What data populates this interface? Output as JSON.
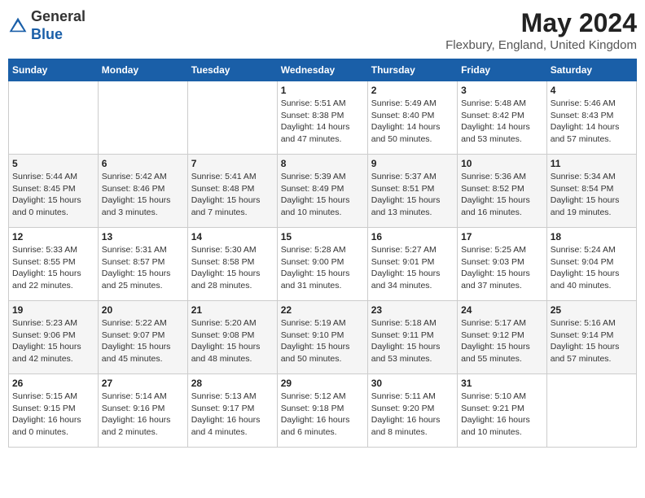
{
  "header": {
    "logo_line1": "General",
    "logo_line2": "Blue",
    "month_year": "May 2024",
    "location": "Flexbury, England, United Kingdom"
  },
  "days_of_week": [
    "Sunday",
    "Monday",
    "Tuesday",
    "Wednesday",
    "Thursday",
    "Friday",
    "Saturday"
  ],
  "weeks": [
    [
      {
        "day": "",
        "info": ""
      },
      {
        "day": "",
        "info": ""
      },
      {
        "day": "",
        "info": ""
      },
      {
        "day": "1",
        "info": "Sunrise: 5:51 AM\nSunset: 8:38 PM\nDaylight: 14 hours\nand 47 minutes."
      },
      {
        "day": "2",
        "info": "Sunrise: 5:49 AM\nSunset: 8:40 PM\nDaylight: 14 hours\nand 50 minutes."
      },
      {
        "day": "3",
        "info": "Sunrise: 5:48 AM\nSunset: 8:42 PM\nDaylight: 14 hours\nand 53 minutes."
      },
      {
        "day": "4",
        "info": "Sunrise: 5:46 AM\nSunset: 8:43 PM\nDaylight: 14 hours\nand 57 minutes."
      }
    ],
    [
      {
        "day": "5",
        "info": "Sunrise: 5:44 AM\nSunset: 8:45 PM\nDaylight: 15 hours\nand 0 minutes."
      },
      {
        "day": "6",
        "info": "Sunrise: 5:42 AM\nSunset: 8:46 PM\nDaylight: 15 hours\nand 3 minutes."
      },
      {
        "day": "7",
        "info": "Sunrise: 5:41 AM\nSunset: 8:48 PM\nDaylight: 15 hours\nand 7 minutes."
      },
      {
        "day": "8",
        "info": "Sunrise: 5:39 AM\nSunset: 8:49 PM\nDaylight: 15 hours\nand 10 minutes."
      },
      {
        "day": "9",
        "info": "Sunrise: 5:37 AM\nSunset: 8:51 PM\nDaylight: 15 hours\nand 13 minutes."
      },
      {
        "day": "10",
        "info": "Sunrise: 5:36 AM\nSunset: 8:52 PM\nDaylight: 15 hours\nand 16 minutes."
      },
      {
        "day": "11",
        "info": "Sunrise: 5:34 AM\nSunset: 8:54 PM\nDaylight: 15 hours\nand 19 minutes."
      }
    ],
    [
      {
        "day": "12",
        "info": "Sunrise: 5:33 AM\nSunset: 8:55 PM\nDaylight: 15 hours\nand 22 minutes."
      },
      {
        "day": "13",
        "info": "Sunrise: 5:31 AM\nSunset: 8:57 PM\nDaylight: 15 hours\nand 25 minutes."
      },
      {
        "day": "14",
        "info": "Sunrise: 5:30 AM\nSunset: 8:58 PM\nDaylight: 15 hours\nand 28 minutes."
      },
      {
        "day": "15",
        "info": "Sunrise: 5:28 AM\nSunset: 9:00 PM\nDaylight: 15 hours\nand 31 minutes."
      },
      {
        "day": "16",
        "info": "Sunrise: 5:27 AM\nSunset: 9:01 PM\nDaylight: 15 hours\nand 34 minutes."
      },
      {
        "day": "17",
        "info": "Sunrise: 5:25 AM\nSunset: 9:03 PM\nDaylight: 15 hours\nand 37 minutes."
      },
      {
        "day": "18",
        "info": "Sunrise: 5:24 AM\nSunset: 9:04 PM\nDaylight: 15 hours\nand 40 minutes."
      }
    ],
    [
      {
        "day": "19",
        "info": "Sunrise: 5:23 AM\nSunset: 9:06 PM\nDaylight: 15 hours\nand 42 minutes."
      },
      {
        "day": "20",
        "info": "Sunrise: 5:22 AM\nSunset: 9:07 PM\nDaylight: 15 hours\nand 45 minutes."
      },
      {
        "day": "21",
        "info": "Sunrise: 5:20 AM\nSunset: 9:08 PM\nDaylight: 15 hours\nand 48 minutes."
      },
      {
        "day": "22",
        "info": "Sunrise: 5:19 AM\nSunset: 9:10 PM\nDaylight: 15 hours\nand 50 minutes."
      },
      {
        "day": "23",
        "info": "Sunrise: 5:18 AM\nSunset: 9:11 PM\nDaylight: 15 hours\nand 53 minutes."
      },
      {
        "day": "24",
        "info": "Sunrise: 5:17 AM\nSunset: 9:12 PM\nDaylight: 15 hours\nand 55 minutes."
      },
      {
        "day": "25",
        "info": "Sunrise: 5:16 AM\nSunset: 9:14 PM\nDaylight: 15 hours\nand 57 minutes."
      }
    ],
    [
      {
        "day": "26",
        "info": "Sunrise: 5:15 AM\nSunset: 9:15 PM\nDaylight: 16 hours\nand 0 minutes."
      },
      {
        "day": "27",
        "info": "Sunrise: 5:14 AM\nSunset: 9:16 PM\nDaylight: 16 hours\nand 2 minutes."
      },
      {
        "day": "28",
        "info": "Sunrise: 5:13 AM\nSunset: 9:17 PM\nDaylight: 16 hours\nand 4 minutes."
      },
      {
        "day": "29",
        "info": "Sunrise: 5:12 AM\nSunset: 9:18 PM\nDaylight: 16 hours\nand 6 minutes."
      },
      {
        "day": "30",
        "info": "Sunrise: 5:11 AM\nSunset: 9:20 PM\nDaylight: 16 hours\nand 8 minutes."
      },
      {
        "day": "31",
        "info": "Sunrise: 5:10 AM\nSunset: 9:21 PM\nDaylight: 16 hours\nand 10 minutes."
      },
      {
        "day": "",
        "info": ""
      }
    ]
  ]
}
